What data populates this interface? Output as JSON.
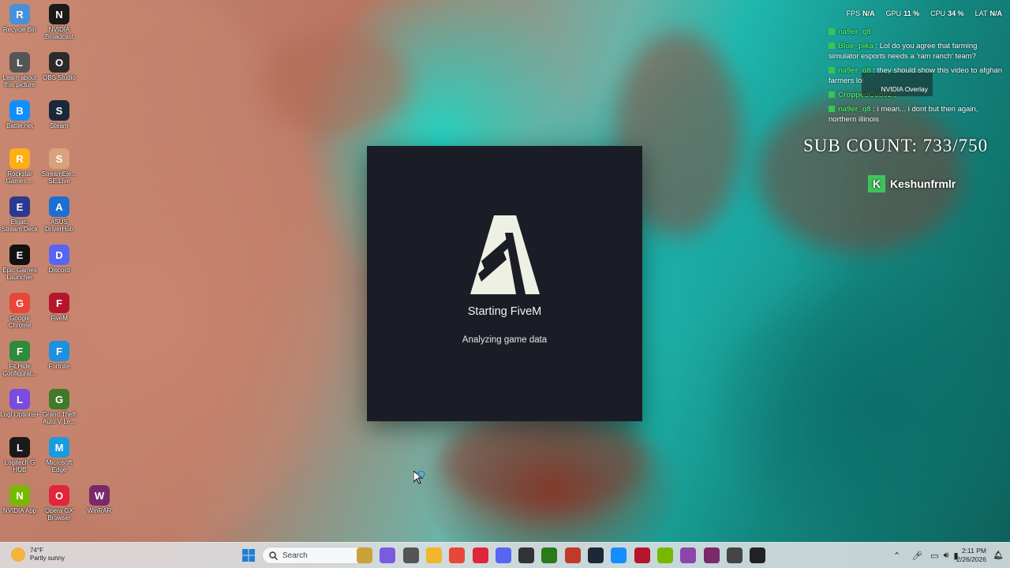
{
  "desktop": {
    "icons": [
      {
        "label": "Recycle Bin",
        "icon": "recycle-bin-icon",
        "color": "#4a90d9"
      },
      {
        "label": "NVIDIA Broadcast",
        "icon": "nvidia-broadcast-icon",
        "color": "#1a1a1a"
      },
      {
        "label": "Learn about this picture",
        "icon": "learn-picture-icon",
        "color": "#555555"
      },
      {
        "label": "OBS Studio",
        "icon": "obs-icon",
        "color": "#2b2b2b"
      },
      {
        "label": "Battle.net",
        "icon": "battlenet-icon",
        "color": "#148eff"
      },
      {
        "label": "Steam",
        "icon": "steam-icon",
        "color": "#1b2838"
      },
      {
        "label": "Rockstar Games ...",
        "icon": "rockstar-icon",
        "color": "#fcaf17"
      },
      {
        "label": "StreamEle... SE.Live",
        "icon": "streamelements-icon",
        "color": "#d9a27a"
      },
      {
        "label": "Elgato Stream Deck",
        "icon": "streamdeck-icon",
        "color": "#2a3a8f"
      },
      {
        "label": "ASUS DriverHub",
        "icon": "asus-driverhub-icon",
        "color": "#1d6fd1"
      },
      {
        "label": "Epic Games Launcher",
        "icon": "epic-games-icon",
        "color": "#121212"
      },
      {
        "label": "Discord",
        "icon": "discord-icon",
        "color": "#5865f2"
      },
      {
        "label": "Google Chrome",
        "icon": "chrome-icon",
        "color": "#e9463a"
      },
      {
        "label": "FiveM",
        "icon": "fivem-icon",
        "color": "#b5162b"
      },
      {
        "label": "FiLHide Configurat...",
        "icon": "hide-config-icon",
        "color": "#2e8b3a"
      },
      {
        "label": "Fortnite",
        "icon": "fortnite-icon",
        "color": "#1f8fe0"
      },
      {
        "label": "Logi Options+",
        "icon": "logi-options-icon",
        "color": "#7b4be0"
      },
      {
        "label": "Grand Theft Auto V Le...",
        "icon": "gta-icon",
        "color": "#3f7a2a"
      },
      {
        "label": "Logitech G HUB",
        "icon": "ghub-icon",
        "color": "#1a1a1a"
      },
      {
        "label": "Microsoft Edge",
        "icon": "edge-icon",
        "color": "#1a9be0"
      },
      {
        "label": "NVIDIA App",
        "icon": "nvidia-app-icon",
        "color": "#76b900"
      },
      {
        "label": "Opera GX Browser",
        "icon": "opera-icon",
        "color": "#e0263a"
      },
      {
        "label": "WinRAR",
        "icon": "winrar-icon",
        "color": "#7a2a6a"
      }
    ]
  },
  "overlay": {
    "perf": [
      {
        "label": "FPS",
        "value": "N/A"
      },
      {
        "label": "GPU",
        "value": "11 %"
      },
      {
        "label": "CPU",
        "value": "34 %"
      },
      {
        "label": "LAT",
        "value": "N/A"
      }
    ],
    "nvidia_overlay_label": "NVIDIA Overlay",
    "chat": [
      {
        "user": "na9er_q8",
        "text": ""
      },
      {
        "user": "Blue_pika",
        "text": ": Lol do you agree that farming simulator esports needs a 'ram ranch' team?"
      },
      {
        "user": "na9er_q8",
        "text": ": they should show this video to afghan farmers lol"
      },
      {
        "user": "CroppedCub02",
        "text": ":"
      },
      {
        "user": "na9er_q8",
        "text": ": i mean... i dont but then again, northern illinois"
      }
    ],
    "sub_count": "SUB COUNT: 733/750",
    "follower_name": "Keshunfrmlr"
  },
  "dialog": {
    "title": "Starting FiveM",
    "status": "Analyzing game data"
  },
  "taskbar": {
    "weather_temp": "74°F",
    "weather_desc": "Partly sunny",
    "search_placeholder": "Search",
    "time": "2:11 PM",
    "date": "2/26/2026"
  }
}
